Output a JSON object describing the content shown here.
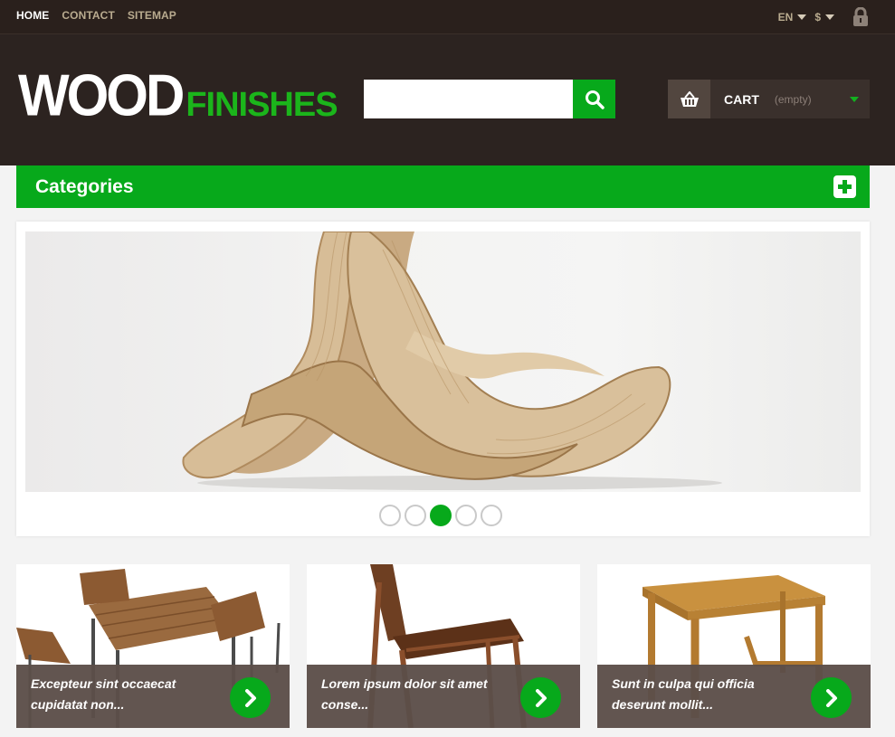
{
  "topbar": {
    "nav": [
      {
        "label": "HOME",
        "active": true
      },
      {
        "label": "CONTACT",
        "active": false
      },
      {
        "label": "SITEMAP",
        "active": false
      }
    ],
    "language": "EN",
    "currency": "$",
    "lock_icon": "lock-icon"
  },
  "header": {
    "logo_part1": "WOOD",
    "logo_part2": "FINISHES",
    "search": {
      "value": "",
      "placeholder": "",
      "icon": "search-icon"
    },
    "cart": {
      "label": "CART",
      "state": "(empty)",
      "icon": "basket-icon"
    }
  },
  "categories": {
    "title": "Categories",
    "icon": "plus-icon"
  },
  "slider": {
    "slide_count": 5,
    "active_index": 2
  },
  "tiles": [
    {
      "caption": "Excepteur sint occaecat cupidatat non..."
    },
    {
      "caption": "Lorem ipsum dolor sit amet conse..."
    },
    {
      "caption": "Sunt in culpa qui officia deserunt mollit..."
    }
  ],
  "colors": {
    "accent": "#07a91b",
    "header_bg": "#2c2320",
    "topbar_bg": "#2a201c",
    "caption_bg": "#5c4e49"
  }
}
